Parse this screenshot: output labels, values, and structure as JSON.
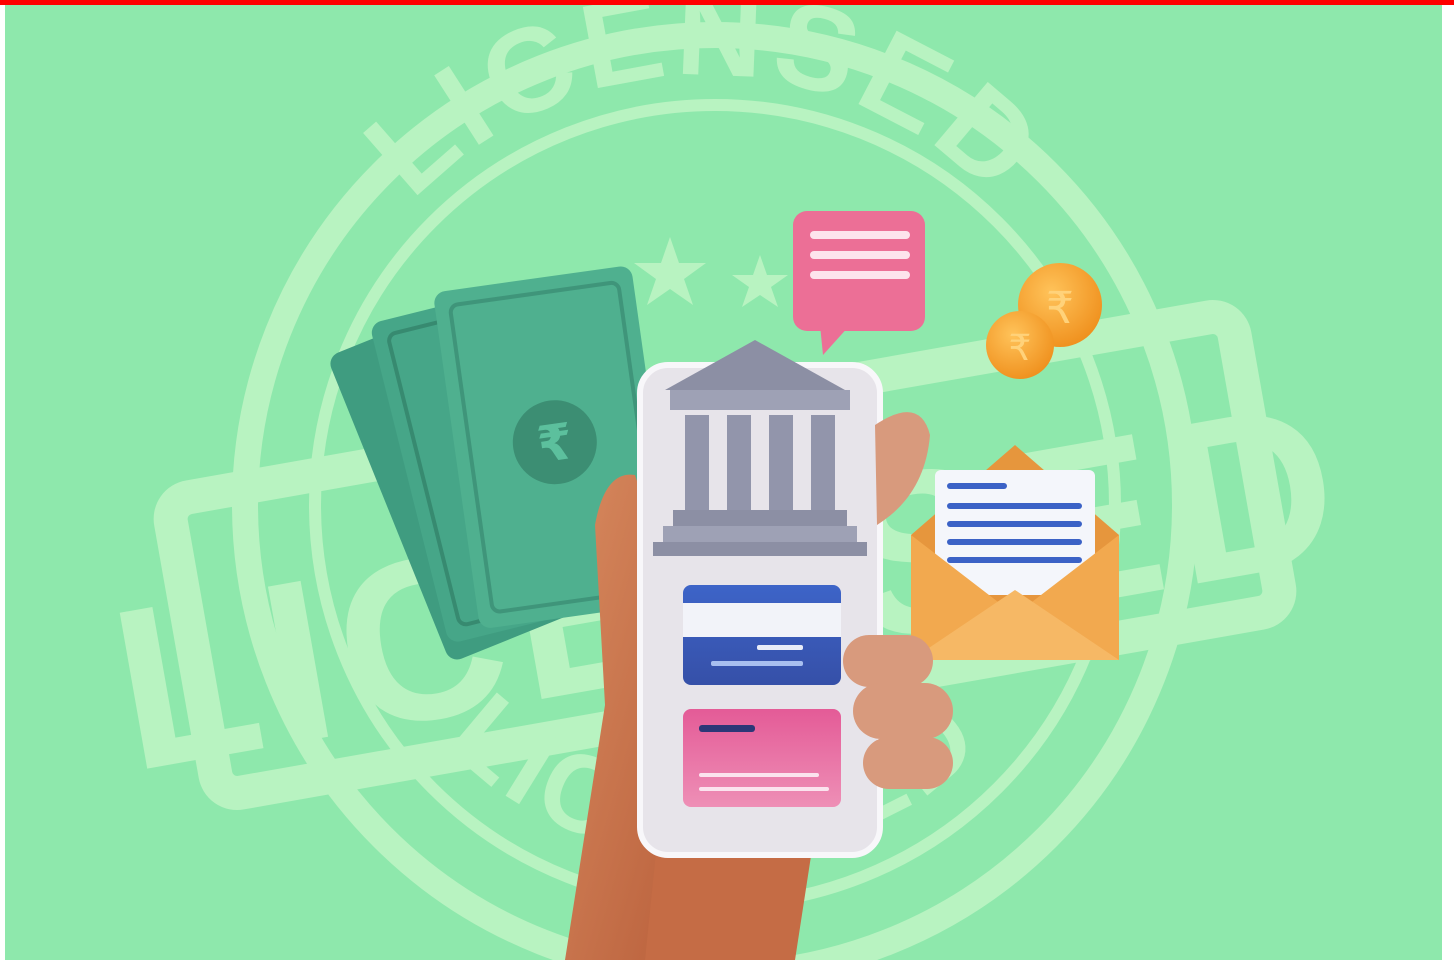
{
  "stamp": {
    "top_word": "LICENSED",
    "band_word": "LICENSED",
    "bottom_word": "LICENSED"
  },
  "icons": {
    "currency_symbol": "₹"
  },
  "colors": {
    "top_bar": "#ff0000",
    "background": "#8ee8ac",
    "stamp": "#c6f7c8",
    "banknote": "#4fb08f",
    "phone_body": "#ece9ee",
    "bank_building": "#8c8fa4",
    "card_blue": "#3b58b8",
    "card_pink": "#e3609a",
    "chat_bubble": "#ec6f96",
    "coin": "#f5a632",
    "envelope": "#f2a94f",
    "hand": "#c8714a"
  }
}
